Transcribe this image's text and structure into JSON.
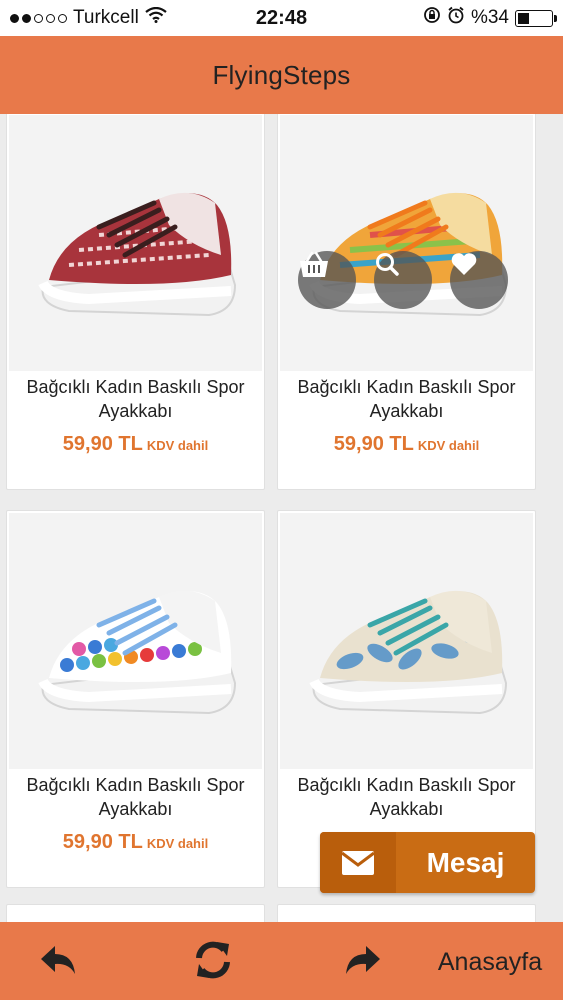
{
  "status_bar": {
    "carrier": "Turkcell",
    "time": "22:48",
    "battery": "%34",
    "battery_level": 0.34
  },
  "header": {
    "title": "FlyingSteps"
  },
  "products": [
    {
      "title": "Bağcıklı Kadın Baskılı Spor Ayakkabı",
      "price": "59,90 TL",
      "tax_note": "KDV dahil"
    },
    {
      "title": "Bağcıklı Kadın Baskılı Spor Ayakkabı",
      "price": "59,90 TL",
      "tax_note": "KDV dahil"
    },
    {
      "title": "Bağcıklı Kadın Baskılı Spor Ayakkabı",
      "price": "59,90 TL",
      "tax_note": "KDV dahil"
    },
    {
      "title": "Bağcıklı Kadın Baskılı Spor Ayakkabı",
      "price": "",
      "tax_note": ""
    }
  ],
  "product_actions": [
    "basket-icon",
    "search-icon",
    "heart-icon"
  ],
  "chat_button": {
    "label": "Mesaj",
    "icon": "envelope-icon"
  },
  "bottom_bar": {
    "back_icon": "reply-arrow-icon",
    "refresh_icon": "refresh-icon",
    "forward_icon": "forward-arrow-icon",
    "home_label": "Anasayfa"
  },
  "colors": {
    "brand": "#e8794a",
    "price": "#e0752f",
    "chat": "#c96c14"
  }
}
